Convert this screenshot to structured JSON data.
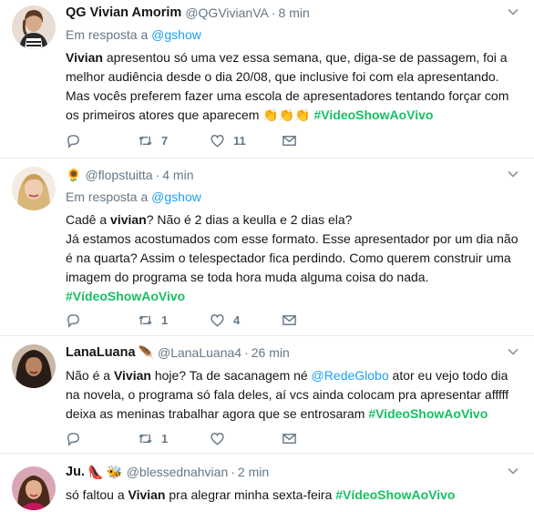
{
  "tweets": [
    {
      "name": "QG Vivian Amorim",
      "handle": "@QGVivianVA",
      "separator": "·",
      "time": "8 min",
      "reply_prefix": "Em resposta a ",
      "reply_to": "@gshow",
      "bold_word": "Vivian",
      "text_rest": " apresentou só uma vez essa semana, que, diga-se de passagem, foi a melhor audiência desde o dia 20/08, que inclusive foi com ela apresentando. Mas vocês preferem fazer uma escola de apresentadores tentando forçar com os primeiros atores que aparecem ",
      "emojis": "👏👏👏",
      "hashtag": "#VideoShowAoVivo",
      "retweets": "7",
      "likes": "11"
    },
    {
      "name_emoji": "🌻",
      "handle": "@flopstuitta",
      "separator": "·",
      "time": "4 min",
      "reply_prefix": "Em resposta a ",
      "reply_to": "@gshow",
      "line1_before": "Cadê a ",
      "bold_word": "vivian",
      "line1_after": "? Não é 2 dias a keulla e 2 dias ela?",
      "text_rest": "Já estamos acostumados com esse formato. Esse apresentador por um dia não é na quarta? Assim o telespectador fica perdindo. Como querem construir uma imagem do programa se toda hora muda alguma coisa do nada.",
      "hashtag": "#VídeoShowAoVivo",
      "retweets": "1",
      "likes": "4"
    },
    {
      "name": "LanaLuana",
      "name_emoji": "🪶",
      "handle": "@LanaLuana4",
      "separator": "·",
      "time": "26 min",
      "text_before": "Não é a ",
      "bold_word": "Vivian",
      "text_mid": " hoje? Ta de sacanagem né ",
      "mention": "@RedeGlobo",
      "text_rest": " ator eu vejo todo dia na novela, o programa só fala deles, aí vcs ainda colocam pra apresentar afffff deixa as meninas trabalhar agora que se entrosaram ",
      "hashtag": "#VideoShowAoVivo",
      "retweets": "1",
      "likes": ""
    },
    {
      "name": "Ju.",
      "name_emoji": "👠 🐝",
      "handle": "@blessednahvian",
      "separator": "·",
      "time": "2 min",
      "text_before": "só faltou a ",
      "bold_word": "Vivian",
      "text_rest": " pra alegrar minha sexta-feira ",
      "hashtag": "#VídeoShowAoVivo"
    }
  ],
  "colors": {
    "hashtag": "#17bf63",
    "link": "#1da1f2",
    "muted": "#657786",
    "border": "#e6ecf0"
  },
  "icons": [
    "reply-icon",
    "retweet-icon",
    "like-icon",
    "direct-message-icon",
    "chevron-down-icon"
  ]
}
